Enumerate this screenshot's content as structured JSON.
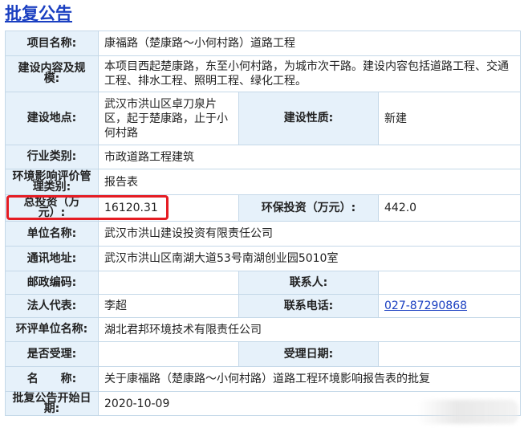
{
  "page": {
    "title": "批复公告"
  },
  "rows": {
    "project_name": {
      "label": "项目名称:",
      "value": "康福路（楚康路～小何村路）道路工程"
    },
    "content_scale": {
      "label": "建设内容及规模:",
      "value": "本项目西起楚康路，东至小何村路，为城市次干路。建设内容包括道路工程、交通工程、排水工程、照明工程、绿化工程。"
    },
    "location": {
      "label": "建设地点:",
      "value": "武汉市洪山区卓刀泉片区，起于楚康路，止于小何村路"
    },
    "nature": {
      "label": "建设性质:",
      "value": "新建"
    },
    "industry": {
      "label": "行业类别:",
      "value": "市政道路工程建筑"
    },
    "eia_category": {
      "label": "环境影响评价管理类别:",
      "value": "报告表"
    },
    "total_investment": {
      "label": "总投资（万元）:",
      "value": "16120.31"
    },
    "env_investment": {
      "label": "环保投资（万元）:",
      "value": "442.0"
    },
    "unit_name": {
      "label": "单位名称:",
      "value": "武汉市洪山建设投资有限责任公司"
    },
    "address": {
      "label": "通讯地址:",
      "value": "武汉市洪山区南湖大道53号南湖创业园5010室"
    },
    "postcode": {
      "label": "邮政编码:",
      "value": ""
    },
    "contact": {
      "label": "联系人:",
      "value": ""
    },
    "legal_rep": {
      "label": "法人代表:",
      "value": "李超"
    },
    "phone": {
      "label": "联系电话:",
      "value": "027-87290868"
    },
    "eia_unit": {
      "label": "环评单位名称:",
      "value": "湖北君邦环境技术有限责任公司"
    },
    "accepted": {
      "label": "是否受理:",
      "value": ""
    },
    "accept_date": {
      "label": "受理日期:",
      "value": ""
    },
    "name": {
      "label": "名　　称:",
      "value": "关于康福路（楚康路～小何村路）道路工程环境影响报告表的批复"
    },
    "start_date": {
      "label": "批复公告开始日期:",
      "value": "2020-10-09"
    }
  },
  "colors": {
    "label_bg": "#e6f1fa",
    "label_text": "#1f4f9c",
    "border": "#c4d8e8",
    "title": "#1a3fc1",
    "highlight": "#e51c23"
  }
}
